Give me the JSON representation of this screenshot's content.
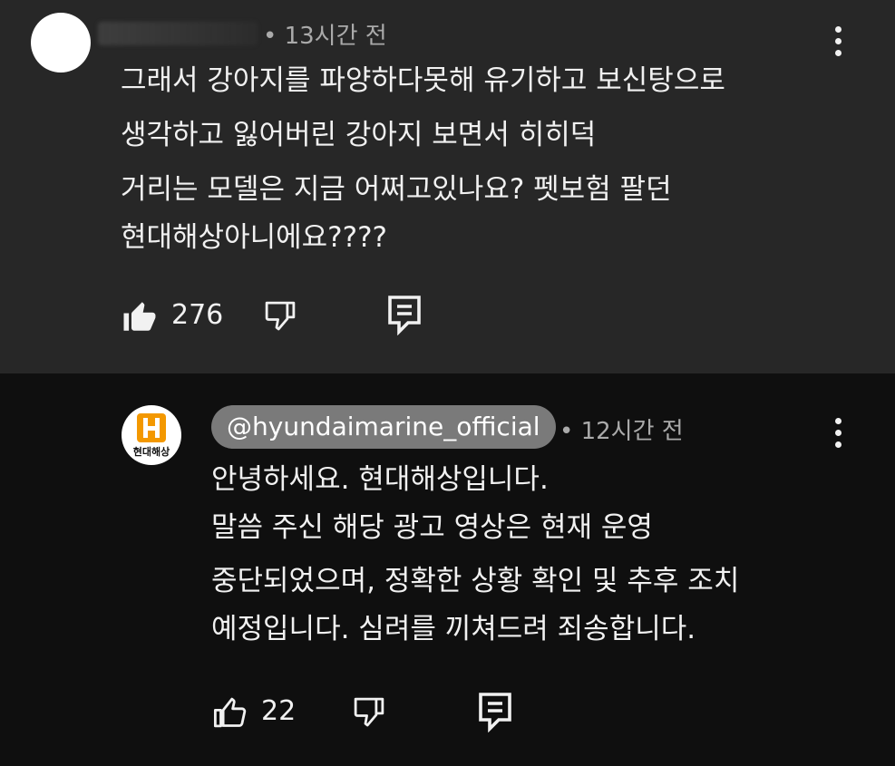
{
  "top_comment": {
    "timestamp": "• 13시간 전",
    "lines": [
      "그래서 강아지를 파양하다못해 유기하고 보신탕으로",
      "생각하고 잃어버린 강아지 보면서 히히덕",
      "거리는 모델은 지금 어쩌고있나요? 펫보험 팔던",
      "현대해상아니에요????"
    ],
    "like_count": "276"
  },
  "reply": {
    "handle": "@hyundaimarine_official",
    "timestamp": "• 12시간 전",
    "avatar_text": "현대해상",
    "lines": [
      "안녕하세요. 현대해상입니다.",
      "말씀 주신 해당 광고 영상은 현재 운영",
      "중단되었으며, 정확한 상황 확인 및 추후 조치",
      "예정입니다. 심려를 끼쳐드려 죄송합니다."
    ],
    "like_count": "22"
  },
  "colors": {
    "top_background": "#272727",
    "reply_background": "#0f0f0f",
    "brand_orange": "#f39800",
    "chip": "#7a7a7a"
  },
  "icons": [
    "like-filled-icon",
    "like-outline-icon",
    "dislike-icon",
    "reply-icon",
    "more-vert-icon"
  ]
}
